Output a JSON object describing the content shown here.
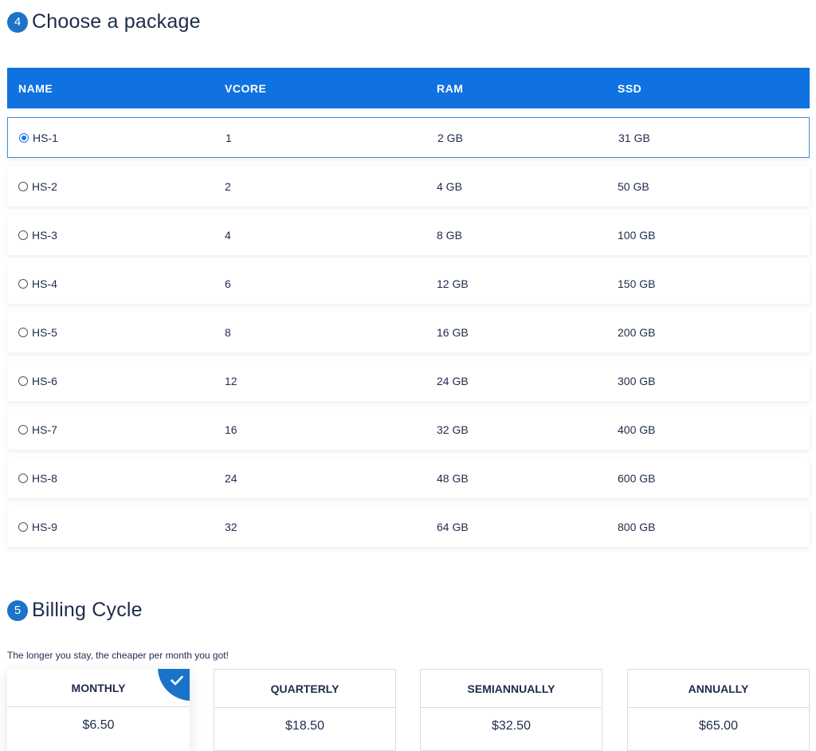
{
  "package_section": {
    "step": "4",
    "title": "Choose a package",
    "columns": [
      "NAME",
      "VCORE",
      "RAM",
      "SSD"
    ],
    "rows": [
      {
        "name": "HS-1",
        "vcore": "1",
        "ram": "2 GB",
        "ssd": "31 GB",
        "selected": true
      },
      {
        "name": "HS-2",
        "vcore": "2",
        "ram": "4 GB",
        "ssd": "50 GB",
        "selected": false
      },
      {
        "name": "HS-3",
        "vcore": "4",
        "ram": "8 GB",
        "ssd": "100 GB",
        "selected": false
      },
      {
        "name": "HS-4",
        "vcore": "6",
        "ram": "12 GB",
        "ssd": "150 GB",
        "selected": false
      },
      {
        "name": "HS-5",
        "vcore": "8",
        "ram": "16 GB",
        "ssd": "200 GB",
        "selected": false
      },
      {
        "name": "HS-6",
        "vcore": "12",
        "ram": "24 GB",
        "ssd": "300 GB",
        "selected": false
      },
      {
        "name": "HS-7",
        "vcore": "16",
        "ram": "32 GB",
        "ssd": "400 GB",
        "selected": false
      },
      {
        "name": "HS-8",
        "vcore": "24",
        "ram": "48 GB",
        "ssd": "600 GB",
        "selected": false
      },
      {
        "name": "HS-9",
        "vcore": "32",
        "ram": "64 GB",
        "ssd": "800 GB",
        "selected": false
      }
    ]
  },
  "billing_section": {
    "step": "5",
    "title": "Billing Cycle",
    "subtitle": "The longer you stay, the cheaper per month you got!",
    "options": [
      {
        "label": "MONTHLY",
        "price": "$6.50",
        "selected": true
      },
      {
        "label": "QUARTERLY",
        "price": "$18.50",
        "selected": false
      },
      {
        "label": "SEMIANNUALLY",
        "price": "$32.50",
        "selected": false
      },
      {
        "label": "ANNUALLY",
        "price": "$65.00",
        "selected": false
      }
    ]
  },
  "colors": {
    "accent": "#0f72e0",
    "badge": "#1a73c8",
    "text": "#1f2b4d"
  },
  "icons": [
    "check-icon",
    "radio-icon"
  ]
}
